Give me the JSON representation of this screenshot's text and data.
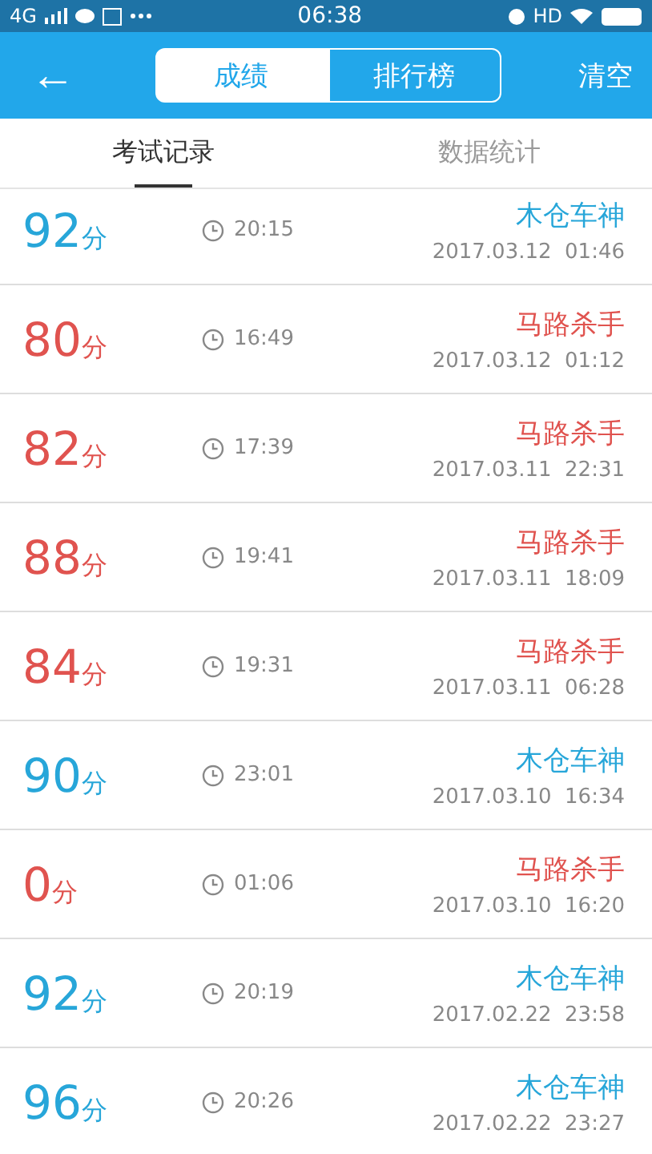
{
  "status_bar": {
    "network": "4G",
    "time": "06:38",
    "hd": "HD"
  },
  "header": {
    "back": "←",
    "segments": [
      {
        "label": "成绩",
        "selected": true
      },
      {
        "label": "排行榜",
        "selected": false
      }
    ],
    "action": "清空"
  },
  "tabs": [
    {
      "label": "考试记录",
      "selected": true
    },
    {
      "label": "数据统计",
      "selected": false
    }
  ],
  "records": [
    {
      "score": "92",
      "unit": "分",
      "duration": "20:15",
      "title": "木仓车神",
      "date": "2017.03.12  01:46",
      "passed": true
    },
    {
      "score": "80",
      "unit": "分",
      "duration": "16:49",
      "title": "马路杀手",
      "date": "2017.03.12  01:12",
      "passed": false
    },
    {
      "score": "82",
      "unit": "分",
      "duration": "17:39",
      "title": "马路杀手",
      "date": "2017.03.11  22:31",
      "passed": false
    },
    {
      "score": "88",
      "unit": "分",
      "duration": "19:41",
      "title": "马路杀手",
      "date": "2017.03.11  18:09",
      "passed": false
    },
    {
      "score": "84",
      "unit": "分",
      "duration": "19:31",
      "title": "马路杀手",
      "date": "2017.03.11  06:28",
      "passed": false
    },
    {
      "score": "90",
      "unit": "分",
      "duration": "23:01",
      "title": "木仓车神",
      "date": "2017.03.10  16:34",
      "passed": true
    },
    {
      "score": "0",
      "unit": "分",
      "duration": "01:06",
      "title": "马路杀手",
      "date": "2017.03.10  16:20",
      "passed": false
    },
    {
      "score": "92",
      "unit": "分",
      "duration": "20:19",
      "title": "木仓车神",
      "date": "2017.02.22  23:58",
      "passed": true
    },
    {
      "score": "96",
      "unit": "分",
      "duration": "20:26",
      "title": "木仓车神",
      "date": "2017.02.22  23:27",
      "passed": true
    }
  ]
}
